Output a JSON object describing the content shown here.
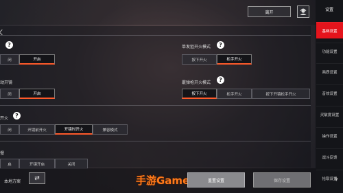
{
  "header": {
    "leave_label": "离开",
    "avatar_icon": "headset-icon"
  },
  "sidebar": {
    "title": "设置",
    "items": [
      {
        "label": "基础设置",
        "active": true
      },
      {
        "label": "功能设置",
        "active": false
      },
      {
        "label": "画质设置",
        "active": false
      },
      {
        "label": "音效设置",
        "active": false
      },
      {
        "label": "灵敏度设置",
        "active": false
      },
      {
        "label": "操作设置",
        "active": false
      },
      {
        "label": "战斗反馈",
        "active": false
      },
      {
        "label": "拾取设置",
        "active": false
      }
    ]
  },
  "sections": {
    "s1_left": {
      "options": [
        "闭",
        "开启"
      ]
    },
    "s1_right": {
      "title": "单发狙开火模式",
      "options": [
        "按下开火",
        "松手开火"
      ]
    },
    "s2_left": {
      "title": "动开镜",
      "options": [
        "闭",
        "开启"
      ]
    },
    "s2_right": {
      "title": "霰弹枪开火模式",
      "options": [
        "按下开火",
        "松手开火",
        "按下开镜松手开火"
      ]
    },
    "s3": {
      "title": "开火",
      "options": [
        "闭",
        "开镜前开火",
        "开镜时开火",
        "兼容模式"
      ]
    },
    "s4": {
      "title": "慢",
      "options": [
        "启",
        "开镜开启",
        "关闭"
      ]
    }
  },
  "help_glyph": "?",
  "footer": {
    "local_label": "本地方案",
    "reset_label": "重置设置",
    "save_label": "保存设置",
    "watermark": "手游Game",
    "swap_icon": "swap-icon"
  }
}
